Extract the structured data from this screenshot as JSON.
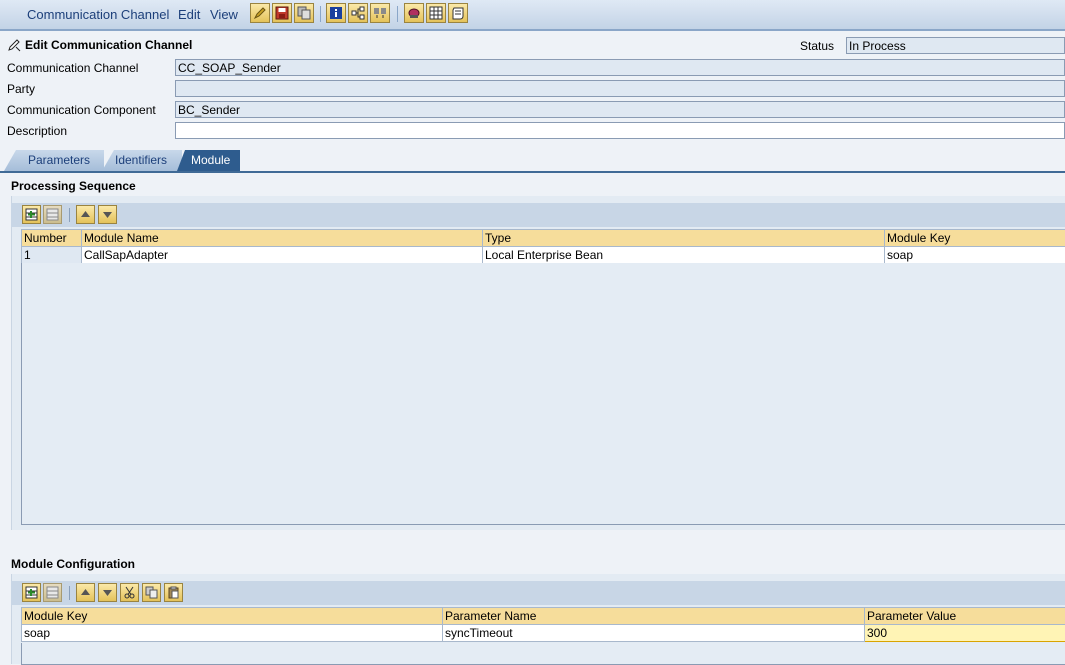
{
  "menu": {
    "communication_channel": "Communication Channel",
    "edit": "Edit",
    "view": "View"
  },
  "toolbar_icons": [
    "edit-icon",
    "save-icon",
    "copy-icon",
    "info-icon",
    "where-used-icon",
    "compare-icon",
    "delete-icon",
    "history-icon",
    "log-icon"
  ],
  "form": {
    "title": "Edit Communication Channel",
    "status_label": "Status",
    "status_value": "In Process",
    "channel_label": "Communication Channel",
    "channel_value": "CC_SOAP_Sender",
    "party_label": "Party",
    "party_value": "",
    "component_label": "Communication Component",
    "component_value": "BC_Sender",
    "description_label": "Description",
    "description_value": ""
  },
  "tabs": [
    "Parameters",
    "Identifiers",
    "Module"
  ],
  "processing": {
    "title": "Processing Sequence",
    "columns": [
      "Number",
      "Module Name",
      "Type",
      "Module Key"
    ],
    "rows": [
      [
        "1",
        "CallSapAdapter",
        "Local Enterprise Bean",
        "soap"
      ]
    ]
  },
  "config": {
    "title": "Module Configuration",
    "columns": [
      "Module Key",
      "Parameter Name",
      "Parameter Value"
    ],
    "rows": [
      [
        "soap",
        "syncTimeout",
        "300"
      ]
    ]
  },
  "colors": {
    "tab_active": "#2e5c8e",
    "header_cell": "#f6dd9b",
    "edit_cell": "#fff4b5"
  }
}
